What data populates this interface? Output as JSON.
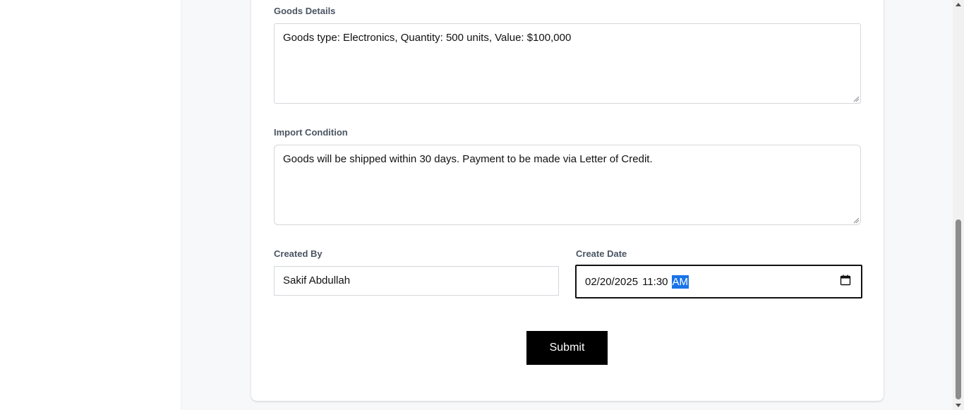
{
  "form": {
    "goods_details": {
      "label": "Goods Details",
      "value": "Goods type: Electronics, Quantity: 500 units, Value: $100,000"
    },
    "import_condition": {
      "label": "Import Condition",
      "value": "Goods will be shipped within 30 days. Payment to be made via Letter of Credit."
    },
    "created_by": {
      "label": "Created By",
      "value": "Sakif Abdullah"
    },
    "create_date": {
      "label": "Create Date",
      "date": "02/20/2025",
      "time": "11:30",
      "meridiem": "AM"
    },
    "submit_label": "Submit"
  },
  "icons": {
    "calendar": "calendar-icon",
    "resize": "resize-grip-icon"
  },
  "colors": {
    "page_bg": "#f7f8fa",
    "card_bg": "#ffffff",
    "label": "#4a5563",
    "submit_bg": "#000000",
    "selection": "#1a73e8"
  }
}
